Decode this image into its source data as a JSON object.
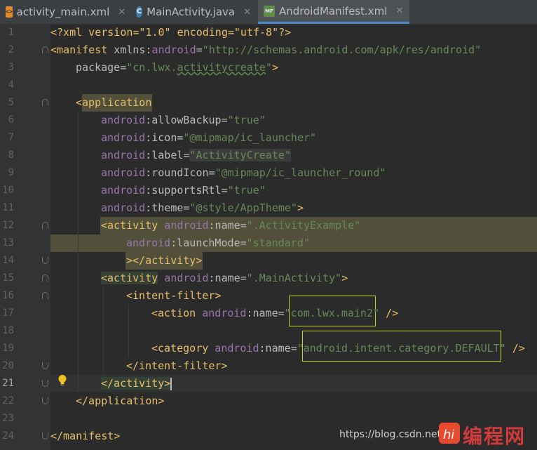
{
  "tabs": [
    {
      "label": "activity_main.xml",
      "icon": "xml-file-icon",
      "active": false
    },
    {
      "label": "MainActivity.java",
      "icon": "java-class-icon",
      "active": false
    },
    {
      "label": "AndroidManifest.xml",
      "icon": "manifest-file-icon",
      "active": true
    }
  ],
  "tab_close_glyph": "✕",
  "line_numbers": [
    "1",
    "2",
    "3",
    "4",
    "5",
    "6",
    "7",
    "8",
    "9",
    "10",
    "11",
    "12",
    "13",
    "14",
    "15",
    "16",
    "17",
    "18",
    "19",
    "20",
    "21",
    "22",
    "23",
    "24"
  ],
  "current_line": "21",
  "code": {
    "l1": {
      "t1": "<?xml version=\"1.0\" encoding=\"utf-8\"?>"
    },
    "l2": {
      "t1": "<manifest",
      "t2": " xmlns:",
      "t3": "android",
      "t4": "=",
      "t5": "\"http://schemas.android.com/apk/res/android\""
    },
    "l3": {
      "t1": "package",
      "t2": "=",
      "t3": "\"cn.lwx.",
      "t4": "activitycreate",
      "t5": "\"",
      "t6": ">"
    },
    "l5": {
      "t1": "<",
      "t2": "application"
    },
    "l6": {
      "t1": "android",
      "t2": ":allowBackup",
      "t3": "=",
      "t4": "\"true\""
    },
    "l7": {
      "t1": "android",
      "t2": ":icon",
      "t3": "=",
      "t4": "\"@mipmap/ic_launcher\""
    },
    "l8": {
      "t1": "android",
      "t2": ":label",
      "t3": "=",
      "t4": "\"ActivityCreate\""
    },
    "l9": {
      "t1": "android",
      "t2": ":roundIcon",
      "t3": "=",
      "t4": "\"@mipmap/ic_launcher_round\""
    },
    "l10": {
      "t1": "android",
      "t2": ":supportsRtl",
      "t3": "=",
      "t4": "\"true\""
    },
    "l11": {
      "t1": "android",
      "t2": ":theme",
      "t3": "=",
      "t4": "\"@style/AppTheme\"",
      "t5": ">"
    },
    "l12": {
      "t1": "<activity",
      "t2": " android",
      "t3": ":name",
      "t4": "=",
      "t5": "\".ActivityExample\""
    },
    "l13": {
      "t1": "android",
      "t2": ":launchMode",
      "t3": "=",
      "t4": "\"standard\""
    },
    "l14": {
      "t1": "></activity>"
    },
    "l15": {
      "t1": "<activity",
      "t2": " android",
      "t3": ":name",
      "t4": "=",
      "t5": "\".MainActivity\"",
      "t6": ">"
    },
    "l16": {
      "t1": "<intent-filter>"
    },
    "l17": {
      "t1": "<action",
      "t2": " android",
      "t3": ":name",
      "t4": "=",
      "t5": "\"com.lwx.main2\"",
      "t6": " />"
    },
    "l19": {
      "t1": "<category",
      "t2": " android",
      "t3": ":name",
      "t4": "=",
      "t5": "\"android.intent.category.DEFAULT\"",
      "t6": " />"
    },
    "l20": {
      "t1": "</intent-filter>"
    },
    "l21": {
      "t1": "</activity>"
    },
    "l22": {
      "t1": "</application>"
    },
    "l24": {
      "t1": "</manifest>"
    }
  },
  "watermark": "https://blog.csdn.net",
  "logo_text": "编程网",
  "colors": {
    "tag": "#e8bf6a",
    "namespace": "#9876aa",
    "value": "#6a8759",
    "highlight": "#52503a",
    "box": "#c4d72a"
  }
}
